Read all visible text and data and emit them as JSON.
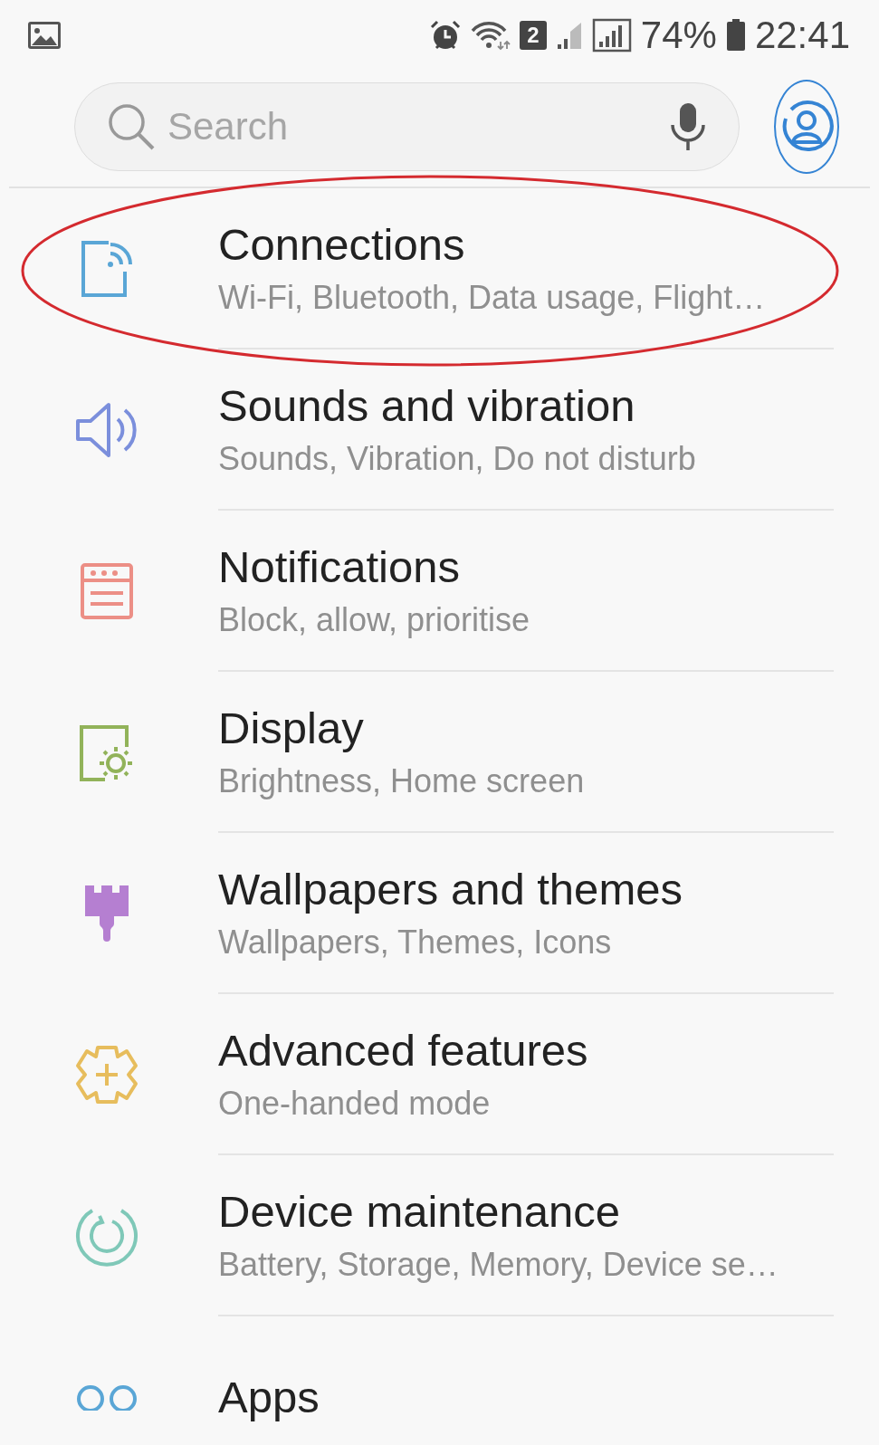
{
  "status_bar": {
    "sim_badge": "2",
    "battery_percent": "74%",
    "time": "22:41"
  },
  "search": {
    "placeholder": "Search"
  },
  "settings": [
    {
      "kind": "connections",
      "title": "Connections",
      "subtitle": "Wi-Fi, Bluetooth, Data usage, Flight…",
      "highlighted": true,
      "color": "#5aa6d6"
    },
    {
      "kind": "sounds",
      "title": "Sounds and vibration",
      "subtitle": "Sounds, Vibration, Do not disturb",
      "highlighted": false,
      "color": "#7b8fdc"
    },
    {
      "kind": "notifications",
      "title": "Notifications",
      "subtitle": "Block, allow, prioritise",
      "highlighted": false,
      "color": "#ec8f86"
    },
    {
      "kind": "display",
      "title": "Display",
      "subtitle": "Brightness, Home screen",
      "highlighted": false,
      "color": "#92b35a"
    },
    {
      "kind": "wallpapers",
      "title": "Wallpapers and themes",
      "subtitle": "Wallpapers, Themes, Icons",
      "highlighted": false,
      "color": "#b57fd1"
    },
    {
      "kind": "advanced",
      "title": "Advanced features",
      "subtitle": "One-handed mode",
      "highlighted": false,
      "color": "#e7bd5d"
    },
    {
      "kind": "maintenance",
      "title": "Device maintenance",
      "subtitle": "Battery, Storage, Memory, Device se…",
      "highlighted": false,
      "color": "#7fc8b8"
    },
    {
      "kind": "apps",
      "title": "Apps",
      "highlighted": false,
      "color": "#5aa6d6"
    }
  ]
}
